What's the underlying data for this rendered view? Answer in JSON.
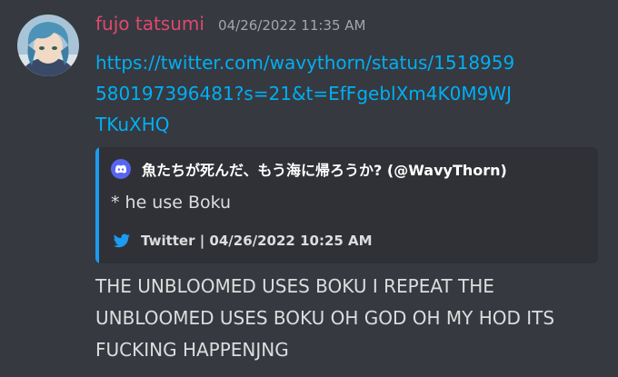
{
  "message": {
    "author": "fujo tatsumi",
    "timestamp": "04/26/2022 11:35 AM",
    "link": "https://twitter.com/wavythorn/status/1518959580197396481?s=21&t=EfFgeblXm4K0M9WJTKuXHQ",
    "embed": {
      "author_name": "魚たちが死んだ、もう海に帰ろうか? (@WavyThorn)",
      "description": "* he use Boku",
      "footer": "Twitter | 04/26/2022 10:25 AM",
      "accent_color": "#1d9bf0"
    },
    "content": "THE UNBLOOMED USES BOKU I REPEAT THE UNBLOOMED USES BOKU OH GOD OH MY HOD ITS FUCKING HAPPENJNG"
  },
  "colors": {
    "background": "#36393f",
    "embed_background": "#2f3136",
    "author": "#e0486f",
    "link": "#00aff4",
    "twitter_blue": "#1d9bf0",
    "discord_blurple": "#5865f2"
  },
  "icons": {
    "avatar": "avatar",
    "embed_author": "discord-icon",
    "embed_footer": "twitter-icon"
  }
}
